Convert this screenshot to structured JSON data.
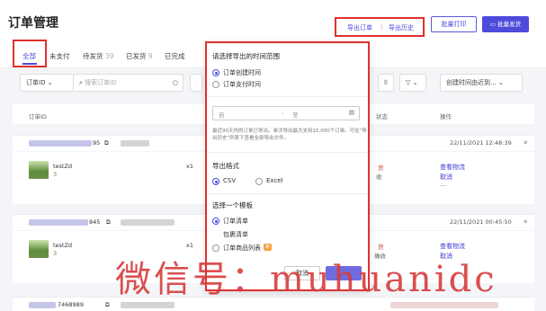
{
  "header": {
    "title": "订单管理",
    "export_order": "导出订单",
    "export_history": "导出历史",
    "batch_print": "批量打印",
    "batch_ship": "批量发货",
    "separator": "|"
  },
  "tabs": [
    {
      "label": "全部",
      "count": ""
    },
    {
      "label": "未支付",
      "count": ""
    },
    {
      "label": "待发货",
      "count": "39"
    },
    {
      "label": "已发货",
      "count": "9"
    },
    {
      "label": "已完成",
      "count": ""
    }
  ],
  "filters": {
    "order_id_select": "订单ID",
    "search_placeholder": "搜索订单ID",
    "sort_select": "创建时间由近到..."
  },
  "table": {
    "col_order_id": "订单ID",
    "col_status": "状态",
    "col_action": "操作"
  },
  "orders": [
    {
      "id_suffix": "95",
      "time": "22/11/2021 12:48:39",
      "product": "testZd",
      "sub": "3",
      "qty": "x1",
      "status_a": "货",
      "status_b": "收",
      "action1": "查看物流",
      "action2": "取消",
      "action3": "..."
    },
    {
      "id_suffix": "845",
      "time": "22/11/2021 00:45:50",
      "product": "testZd",
      "sub": "3",
      "qty": "x1",
      "status_a": "货",
      "status_b": "确收",
      "action1": "查看物流",
      "action2": "取消",
      "action3": ""
    },
    {
      "id_suffix": "7468989",
      "time": "",
      "product": "",
      "sub": "",
      "qty": "",
      "status_a": "",
      "status_b": "",
      "action1": "",
      "action2": "",
      "action3": ""
    }
  ],
  "popover": {
    "time_range_title": "请选择导出的时间范围",
    "time_options": [
      "订单创建时间",
      "订单支付时间"
    ],
    "date_start": "自",
    "date_dash": "-",
    "date_end": "至",
    "note": "最近90天内的订单已导出。单次导出最大支持15,000个订单。可在\"导出历史\"列表下查看全部导出文件。",
    "format_title": "导出格式",
    "formats": [
      "CSV",
      "Excel"
    ],
    "template_title": "选择一个模板",
    "templates": [
      "订单清单",
      "包裹清单",
      "订单商品列表"
    ],
    "new_badge": "新",
    "cancel": "取消"
  },
  "watermark": "微信号：muhuanidc",
  "colors": {
    "accent": "#4a4adf",
    "highlight_box": "#e0302f",
    "watermark": "#d63c3c"
  }
}
